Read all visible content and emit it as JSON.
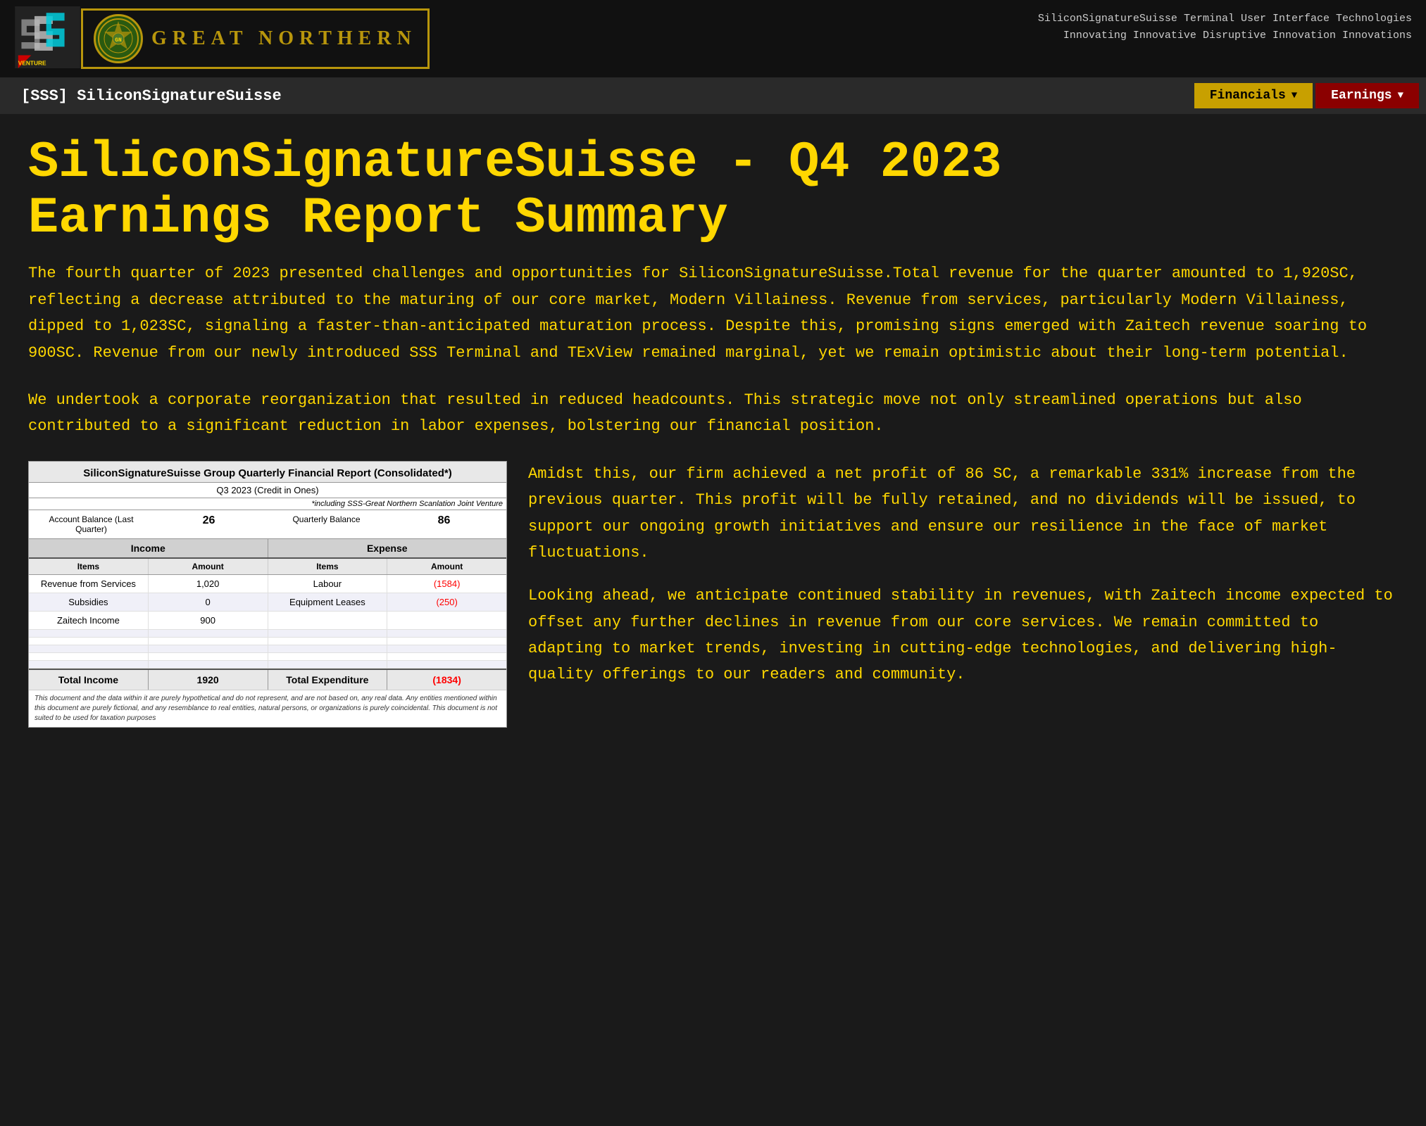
{
  "header": {
    "tagline_line1": "SiliconSignatureSuisse Terminal User Interface Technologies",
    "tagline_line2": "Innovating Innovative Disruptive Innovation Innovations",
    "gn_text": "GREAT   NORTHERN",
    "gn_emblem": "⊕"
  },
  "navbar": {
    "brand": "[SSS] SiliconSignatureSuisse",
    "financials_btn": "Financials",
    "earnings_btn": "Earnings"
  },
  "page": {
    "title_line1": "SiliconSignatureSuisse - Q4 2023",
    "title_line2": "Earnings Report Summary",
    "intro": "The fourth quarter of 2023 presented challenges and opportunities for SiliconSignatureSuisse.Total revenue for the quarter amounted to 1,920SC, reflecting a decrease attributed to the maturing of our core market, Modern Villainess. Revenue from services, particularly Modern Villainess, dipped to 1,023SC, signaling a faster-than-anticipated maturation process. Despite this, promising signs emerged with Zaitech revenue soaring to 900SC. Revenue from our newly introduced SSS Terminal and TExView remained marginal, yet we remain optimistic about their long-term potential.",
    "reorg": "We undertook a corporate reorganization that resulted in reduced headcounts. This strategic move not only streamlined operations but also contributed to a significant reduction in labor expenses, bolstering our financial position.",
    "right_para1": "Amidst this, our firm achieved a net profit of 86 SC, a remarkable 331% increase from the previous quarter. This profit will be fully retained, and no dividends will be issued, to support our ongoing growth initiatives and ensure our resilience in the face of market fluctuations.",
    "right_para2": "Looking ahead, we anticipate continued stability in revenues, with Zaitech income expected to offset any further declines in revenue from our core services. We remain committed to adapting to market trends, investing in cutting-edge technologies, and delivering high-quality offerings to our readers and community."
  },
  "table": {
    "title": "SiliconSignatureSuisse Group Quarterly Financial Report (Consolidated*)",
    "subtitle": "Q3 2023 (Credit in Ones)",
    "note": "*including SSS-Great Northern Scanlation Joint Venture",
    "account_label": "Account Balance (Last Quarter)",
    "account_value": "26",
    "quarterly_label": "Quarterly Balance",
    "quarterly_value": "86",
    "income_header": "Income",
    "expense_header": "Expense",
    "col_items": "Items",
    "col_amount": "Amount",
    "col_exp_items": "Items",
    "col_exp_amount": "Amount",
    "rows": [
      {
        "inc_item": "Revenue from Services",
        "inc_amount": "1,020",
        "exp_item": "Labour",
        "exp_amount": "(1584)"
      },
      {
        "inc_item": "Subsidies",
        "inc_amount": "0",
        "exp_item": "Equipment Leases",
        "exp_amount": "(250)"
      },
      {
        "inc_item": "Zaitech Income",
        "inc_amount": "900",
        "exp_item": "",
        "exp_amount": ""
      },
      {
        "inc_item": "",
        "inc_amount": "",
        "exp_item": "",
        "exp_amount": ""
      },
      {
        "inc_item": "",
        "inc_amount": "",
        "exp_item": "",
        "exp_amount": ""
      },
      {
        "inc_item": "",
        "inc_amount": "",
        "exp_item": "",
        "exp_amount": ""
      },
      {
        "inc_item": "",
        "inc_amount": "",
        "exp_item": "",
        "exp_amount": ""
      },
      {
        "inc_item": "",
        "inc_amount": "",
        "exp_item": "",
        "exp_amount": ""
      }
    ],
    "total_income_label": "Total Income",
    "total_income_value": "1920",
    "total_exp_label": "Total Expenditure",
    "total_exp_value": "(1834)",
    "disclaimer": "This document and the data within it are purely hypothetical and do not represent, and are not based on, any real data. Any entities mentioned within this document are purely fictional, and any resemblance to real entities, natural persons, or organizations is purely coincidental. This document is not suited to be used for taxation purposes"
  }
}
